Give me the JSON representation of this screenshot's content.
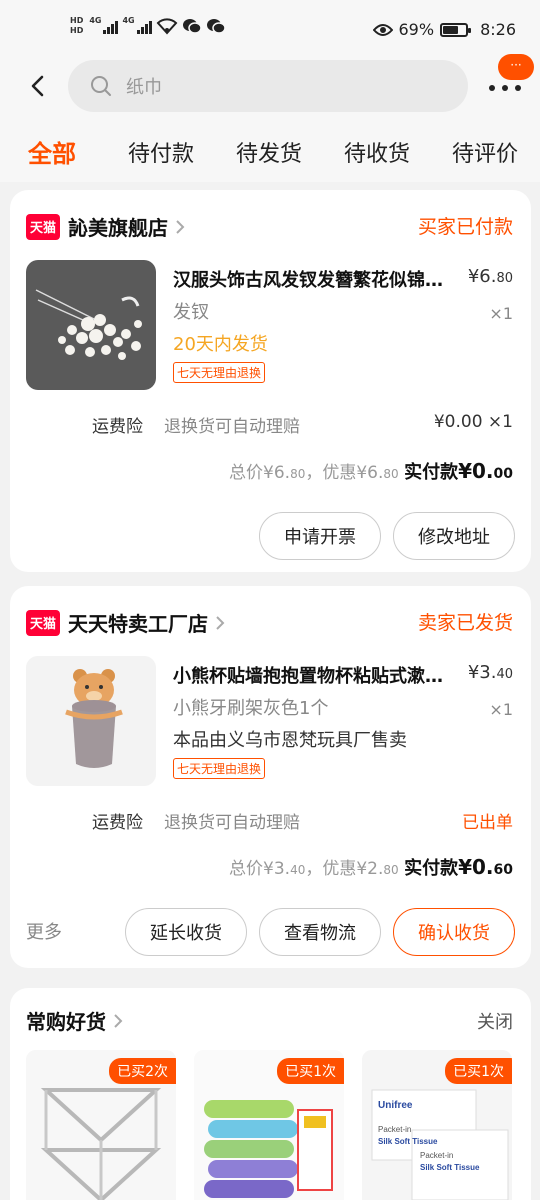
{
  "status_bar": {
    "hd1": "HD",
    "hd2": "HD",
    "net1": "4G",
    "net2": "4G",
    "battery_pct": "69%",
    "battery_level": 0.69,
    "time": "8:26"
  },
  "search": {
    "placeholder": "纸巾",
    "badge": "···"
  },
  "tabs": [
    "全部",
    "待付款",
    "待发货",
    "待收货",
    "待评价"
  ],
  "orders": [
    {
      "platform": "天猫",
      "shop": "訫美旗舰店",
      "status": "买家已付款",
      "title": "汉服头饰古风发钗发簪繁花似锦珍珠步摇",
      "price_int": "¥6.",
      "price_dec": "80",
      "qty": "×1",
      "sku": "发钗",
      "ship": "20天内发货",
      "tag": "七天无理由退换",
      "insurance_label": "运费险",
      "insurance_desc": "退换货可自动理赔",
      "insurance_value": "¥0.00 ×1",
      "total_label": "总价",
      "total_int": "¥6.",
      "total_dec": "80",
      "discount_label": "，优惠",
      "discount_int": "¥6.",
      "discount_dec": "80",
      "paid_label": "实付款",
      "paid_int": "¥0.",
      "paid_dec": "00",
      "buttons": [
        "申请开票",
        "修改地址"
      ]
    },
    {
      "platform": "天猫",
      "shop": "天天特卖工厂店",
      "status": "卖家已发货",
      "title": "小熊杯贴墙抱抱置物杯粘贴式漱口杯",
      "price_int": "¥3.",
      "price_dec": "40",
      "qty": "×1",
      "sku": "小熊牙刷架灰色1个",
      "ship": "本品由义乌市恩梵玩具厂售卖",
      "tag": "七天无理由退换",
      "insurance_label": "运费险",
      "insurance_desc": "退换货可自动理赔",
      "insurance_value": "已出单",
      "total_label": "总价",
      "total_int": "¥3.",
      "total_dec": "40",
      "discount_label": "，优惠",
      "discount_int": "¥2.",
      "discount_dec": "80",
      "paid_label": "实付款",
      "paid_int": "¥0.",
      "paid_dec": "60",
      "more": "更多",
      "buttons": [
        "延长收货",
        "查看物流",
        "确认收货"
      ]
    }
  ],
  "frequent": {
    "title": "常购好货",
    "close": "关闭",
    "items": [
      {
        "badge": "已买2次"
      },
      {
        "badge": "已买1次"
      },
      {
        "badge": "已买1次",
        "brand": "Unifree",
        "label1": "Packet-in",
        "label2": "Silk Soft Tissue"
      }
    ]
  },
  "colors": {
    "accent": "#ff5000",
    "tmall": "#ff0036",
    "ship_orange": "#f5a623"
  }
}
